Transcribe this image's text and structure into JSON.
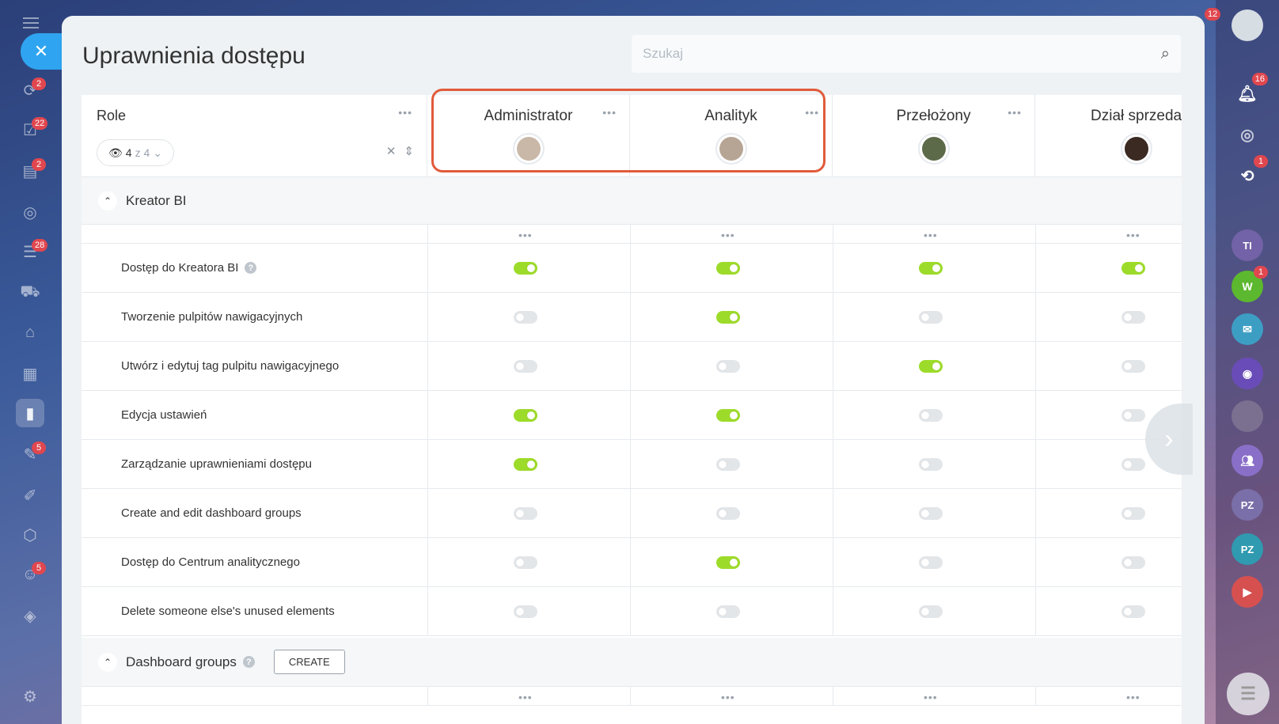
{
  "page": {
    "title": "Uprawnienia dostępu",
    "search_placeholder": "Szukaj"
  },
  "left_nav": {
    "badges": [
      "2",
      "22",
      "2",
      "28",
      "5",
      "5"
    ]
  },
  "right_nav": {
    "top_badge": "12",
    "notifications_badge": "16",
    "sync_badge": "1",
    "w_initial": "W",
    "w_badge": "1",
    "pz1": "PZ",
    "pz2": "PZ",
    "ti": "TI"
  },
  "roles": {
    "header_label": "Role",
    "filter_count": "4",
    "filter_sep": "z 4",
    "columns": [
      "Administrator",
      "Analityk",
      "Przełożony",
      "Dział sprzedaży"
    ]
  },
  "sections": [
    {
      "title": "Kreator BI",
      "rows": [
        {
          "label": "Dostęp do Kreatora BI",
          "help": true,
          "values": [
            true,
            true,
            true,
            true
          ]
        },
        {
          "label": "Tworzenie pulpitów nawigacyjnych",
          "values": [
            false,
            true,
            false,
            false
          ]
        },
        {
          "label": "Utwórz i edytuj tag pulpitu nawigacyjnego",
          "values": [
            false,
            false,
            true,
            false
          ]
        },
        {
          "label": "Edycja ustawień",
          "values": [
            true,
            true,
            false,
            false
          ]
        },
        {
          "label": "Zarządzanie uprawnieniami dostępu",
          "values": [
            true,
            false,
            false,
            false
          ]
        },
        {
          "label": "Create and edit dashboard groups",
          "values": [
            false,
            false,
            false,
            false
          ]
        },
        {
          "label": "Dostęp do Centrum analitycznego",
          "values": [
            false,
            true,
            false,
            false
          ]
        },
        {
          "label": "Delete someone else's unused elements",
          "values": [
            false,
            false,
            false,
            false
          ]
        }
      ]
    },
    {
      "title": "Dashboard groups",
      "create_label": "CREATE"
    }
  ],
  "colors": {
    "accent": "#2fa4f0",
    "toggle_on": "#9ddb2a",
    "highlight": "#e15b3a",
    "badge": "#e0474f"
  }
}
